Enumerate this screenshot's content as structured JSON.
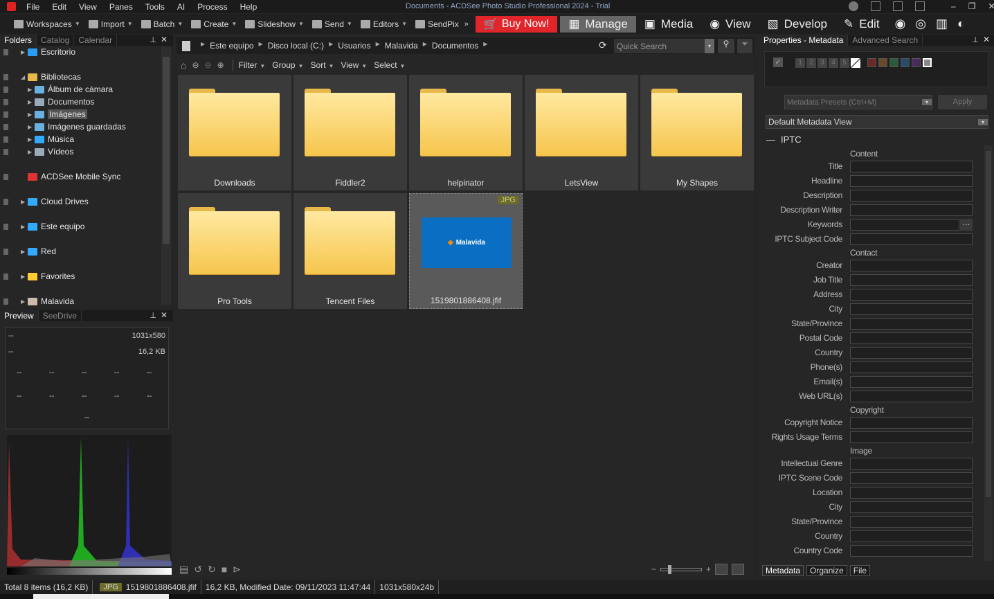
{
  "app": {
    "title": "Documents - ACDSee Photo Studio Professional 2024 - Trial",
    "menu": [
      "File",
      "Edit",
      "View",
      "Panes",
      "Tools",
      "AI",
      "Process",
      "Help"
    ]
  },
  "toolbar": {
    "items": [
      "Workspaces",
      "Import",
      "Batch",
      "Create",
      "Slideshow",
      "Send",
      "Editors",
      "SendPix"
    ],
    "buy": "Buy Now!",
    "modes": [
      "Manage",
      "Media",
      "View",
      "Develop",
      "Edit"
    ],
    "active_mode": "Manage",
    "accent": "#e0262b"
  },
  "left": {
    "tabs": [
      "Folders",
      "Catalog",
      "Calendar"
    ],
    "tree": [
      {
        "label": "Escritorio",
        "level": 0
      },
      {
        "label": "Bibliotecas",
        "level": 0
      },
      {
        "label": "Álbum de cámara",
        "level": 1
      },
      {
        "label": "Documentos",
        "level": 1
      },
      {
        "label": "Imágenes",
        "level": 1,
        "selected": true
      },
      {
        "label": "Imágenes guardadas",
        "level": 1
      },
      {
        "label": "Música",
        "level": 1
      },
      {
        "label": "Vídeos",
        "level": 1
      },
      {
        "label": "ACDSee Mobile Sync",
        "level": 0
      },
      {
        "label": "Cloud Drives",
        "level": 0
      },
      {
        "label": "Este equipo",
        "level": 0
      },
      {
        "label": "Red",
        "level": 0
      },
      {
        "label": "Favorites",
        "level": 0
      },
      {
        "label": "Malavida",
        "level": 0
      }
    ],
    "preview_tabs": [
      "Preview",
      "SeeDrive"
    ],
    "preview": {
      "dims": "1031x580",
      "size": "16,2 KB",
      "placeholder": "--"
    }
  },
  "center": {
    "breadcrumb": [
      "Este equipo",
      "Disco local (C:)",
      "Usuarios",
      "Malavida",
      "Documentos"
    ],
    "search_placeholder": "Quick Search",
    "filters": [
      "Filter",
      "Group",
      "Sort",
      "View",
      "Select"
    ],
    "items": [
      {
        "name": "Downloads",
        "type": "folder"
      },
      {
        "name": "Fiddler2",
        "type": "folder"
      },
      {
        "name": "helpinator",
        "type": "folder"
      },
      {
        "name": "LetsView",
        "type": "folder"
      },
      {
        "name": "My Shapes",
        "type": "folder"
      },
      {
        "name": "Pro Tools",
        "type": "folder"
      },
      {
        "name": "Tencent Files",
        "type": "folder"
      },
      {
        "name": "1519801886408.jfif",
        "type": "image",
        "badge": "JPG",
        "logo_text": "Malavida",
        "selected": true
      }
    ]
  },
  "right": {
    "tabs": [
      "Properties - Metadata",
      "Advanced Search"
    ],
    "ratings": [
      "1",
      "2",
      "3",
      "4",
      "5"
    ],
    "label_colors": [
      "#6a2a2a",
      "#6a4a2a",
      "#2a5a3a",
      "#2a4a6a",
      "#4a2a5a",
      "#888888"
    ],
    "presets_placeholder": "Metadata Presets (Ctrl+M)",
    "apply": "Apply",
    "view": "Default Metadata View",
    "section": "IPTC",
    "groups": [
      {
        "title": "Content",
        "fields": [
          "Title",
          "Headline",
          "Description",
          "Description Writer",
          "Keywords",
          "IPTC Subject Code"
        ]
      },
      {
        "title": "Contact",
        "fields": [
          "Creator",
          "Job Title",
          "Address",
          "City",
          "State/Province",
          "Postal Code",
          "Country",
          "Phone(s)",
          "Email(s)",
          "Web URL(s)"
        ]
      },
      {
        "title": "Copyright",
        "fields": [
          "Copyright Notice",
          "Rights Usage Terms"
        ]
      },
      {
        "title": "Image",
        "fields": [
          "Intellectual Genre",
          "IPTC Scene Code",
          "Location",
          "City",
          "State/Province",
          "Country",
          "Country Code"
        ]
      }
    ],
    "bottom_tabs": [
      "Metadata",
      "Organize",
      "File"
    ]
  },
  "status": {
    "total": "Total 8 items  (16,2 KB)",
    "badge": "JPG",
    "file": "1519801886408.jfif",
    "info": "16,2 KB, Modified Date: 09/11/2023 11:47:44",
    "dims": "1031x580x24b"
  }
}
